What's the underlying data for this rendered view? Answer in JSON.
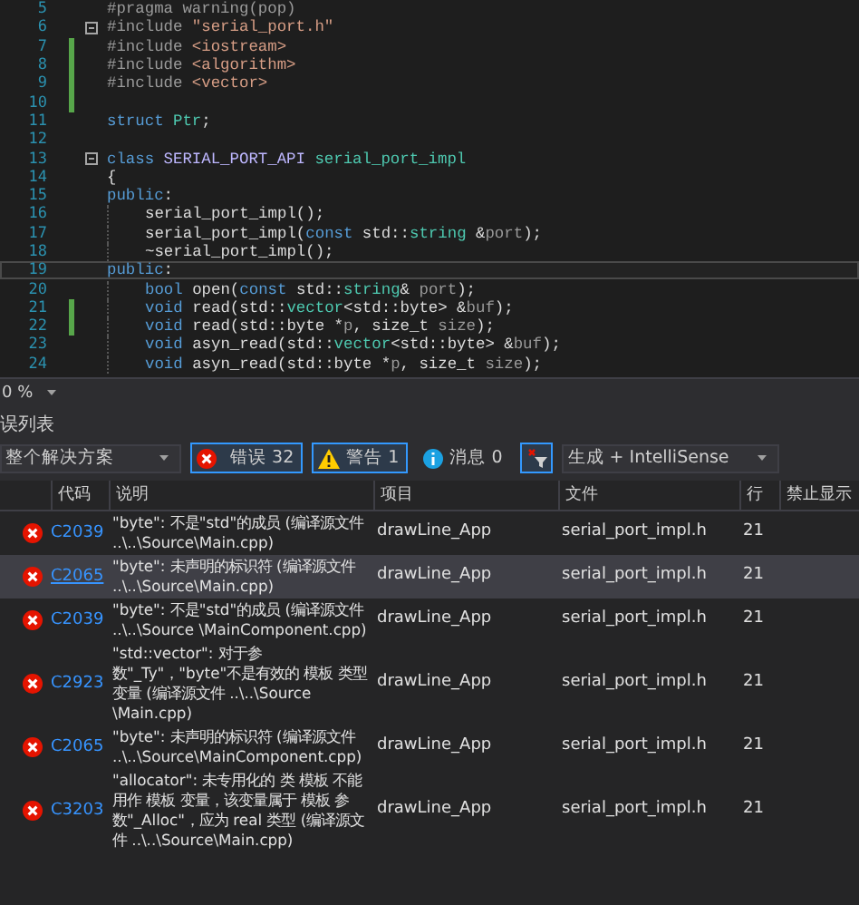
{
  "editor": {
    "lines": [
      {
        "n": "5",
        "fold": false,
        "changed": false,
        "indented": false,
        "current": false,
        "tokens": [
          {
            "t": "#pragma warning(pop)",
            "kind": "directive"
          }
        ]
      },
      {
        "n": "6",
        "fold": true,
        "changed": false,
        "indented": false,
        "current": false,
        "tokens": [
          {
            "t": "#include ",
            "kind": "directive"
          },
          {
            "t": "\"serial_port.h\"",
            "kind": "string"
          }
        ]
      },
      {
        "n": "7",
        "fold": false,
        "changed": true,
        "indented": false,
        "current": false,
        "tokens": [
          {
            "t": "#include ",
            "kind": "directive"
          },
          {
            "t": "<iostream>",
            "kind": "string"
          }
        ]
      },
      {
        "n": "8",
        "fold": false,
        "changed": true,
        "indented": false,
        "current": false,
        "tokens": [
          {
            "t": "#include ",
            "kind": "directive"
          },
          {
            "t": "<algorithm>",
            "kind": "string"
          }
        ]
      },
      {
        "n": "9",
        "fold": false,
        "changed": true,
        "indented": false,
        "current": false,
        "tokens": [
          {
            "t": "#include ",
            "kind": "directive"
          },
          {
            "t": "<vector>",
            "kind": "string"
          }
        ]
      },
      {
        "n": "10",
        "fold": false,
        "changed": true,
        "indented": false,
        "current": false
      },
      {
        "n": "11",
        "fold": false,
        "changed": false,
        "indented": false,
        "current": false,
        "tokens": [
          {
            "t": "struct ",
            "kind": "keyword"
          },
          {
            "t": "Ptr",
            "kind": "type"
          },
          {
            "t": ";",
            "kind": "plain"
          }
        ]
      },
      {
        "n": "12",
        "fold": false,
        "changed": false,
        "indented": false,
        "current": false
      },
      {
        "n": "13",
        "fold": true,
        "changed": false,
        "indented": false,
        "current": false,
        "tokens": [
          {
            "t": "class ",
            "kind": "keyword"
          },
          {
            "t": "SERIAL_PORT_API ",
            "kind": "macro"
          },
          {
            "t": "serial_port_impl",
            "kind": "type"
          }
        ]
      },
      {
        "n": "14",
        "fold": false,
        "changed": false,
        "indented": false,
        "current": false,
        "tokens": [
          {
            "t": "{",
            "kind": "plain"
          }
        ]
      },
      {
        "n": "15",
        "fold": false,
        "changed": false,
        "indented": false,
        "current": false,
        "tokens": [
          {
            "t": "public",
            "kind": "keyword"
          },
          {
            "t": ":",
            "kind": "plain"
          }
        ]
      },
      {
        "n": "16",
        "fold": false,
        "changed": false,
        "indented": true,
        "current": false,
        "tokens": [
          {
            "t": "serial_port_impl();",
            "kind": "plain"
          }
        ]
      },
      {
        "n": "17",
        "fold": false,
        "changed": false,
        "indented": true,
        "current": false,
        "tokens": [
          {
            "t": "serial_port_impl(",
            "kind": "plain"
          },
          {
            "t": "const ",
            "kind": "keyword"
          },
          {
            "t": "std::",
            "kind": "plain"
          },
          {
            "t": "string ",
            "kind": "type"
          },
          {
            "t": "&",
            "kind": "plain"
          },
          {
            "t": "port",
            "kind": "param"
          },
          {
            "t": ");",
            "kind": "plain"
          }
        ]
      },
      {
        "n": "18",
        "fold": false,
        "changed": false,
        "indented": true,
        "current": false,
        "tokens": [
          {
            "t": "~serial_port_impl();",
            "kind": "plain"
          }
        ]
      },
      {
        "n": "19",
        "fold": false,
        "changed": false,
        "indented": false,
        "current": true,
        "tokens": [
          {
            "t": "public",
            "kind": "keyword"
          },
          {
            "t": ":",
            "kind": "plain"
          }
        ]
      },
      {
        "n": "20",
        "fold": false,
        "changed": false,
        "indented": true,
        "current": false,
        "tokens": [
          {
            "t": "bool ",
            "kind": "keyword"
          },
          {
            "t": "open(",
            "kind": "plain"
          },
          {
            "t": "const ",
            "kind": "keyword"
          },
          {
            "t": "std::",
            "kind": "plain"
          },
          {
            "t": "string",
            "kind": "type"
          },
          {
            "t": "& ",
            "kind": "plain"
          },
          {
            "t": "port",
            "kind": "param"
          },
          {
            "t": ");",
            "kind": "plain"
          }
        ]
      },
      {
        "n": "21",
        "fold": false,
        "changed": true,
        "indented": true,
        "current": false,
        "tokens": [
          {
            "t": "void ",
            "kind": "keyword"
          },
          {
            "t": "read(std::",
            "kind": "plain"
          },
          {
            "t": "vector",
            "kind": "type"
          },
          {
            "t": "<std::byte> &",
            "kind": "plain"
          },
          {
            "t": "buf",
            "kind": "param"
          },
          {
            "t": ");",
            "kind": "plain"
          }
        ]
      },
      {
        "n": "22",
        "fold": false,
        "changed": true,
        "indented": true,
        "current": false,
        "tokens": [
          {
            "t": "void ",
            "kind": "keyword"
          },
          {
            "t": "read(std::byte *",
            "kind": "plain"
          },
          {
            "t": "p",
            "kind": "param"
          },
          {
            "t": ", size_t ",
            "kind": "plain"
          },
          {
            "t": "size",
            "kind": "param"
          },
          {
            "t": ");",
            "kind": "plain"
          }
        ]
      },
      {
        "n": "23",
        "fold": false,
        "changed": false,
        "indented": true,
        "current": false,
        "tokens": [
          {
            "t": "void ",
            "kind": "keyword"
          },
          {
            "t": "asyn_read(std::",
            "kind": "plain"
          },
          {
            "t": "vector",
            "kind": "type"
          },
          {
            "t": "<std::byte> &",
            "kind": "plain"
          },
          {
            "t": "buf",
            "kind": "param"
          },
          {
            "t": ");",
            "kind": "plain"
          }
        ]
      },
      {
        "n": "24",
        "fold": false,
        "changed": false,
        "indented": true,
        "current": false,
        "tokens": [
          {
            "t": "void ",
            "kind": "keyword"
          },
          {
            "t": "asyn_read(std::byte *",
            "kind": "plain"
          },
          {
            "t": "p",
            "kind": "param"
          },
          {
            "t": ", size_t ",
            "kind": "plain"
          },
          {
            "t": "size",
            "kind": "param"
          },
          {
            "t": ");",
            "kind": "plain"
          }
        ]
      }
    ],
    "zoom": "0 %"
  },
  "error_list": {
    "title": "误列表",
    "scope": "整个解决方案",
    "filters": [
      {
        "kind": "error",
        "label": "错误 32",
        "selected": true
      },
      {
        "kind": "warning",
        "label": "警告 1",
        "selected": true
      },
      {
        "kind": "info",
        "label": "消息 0",
        "selected": false
      }
    ],
    "source": "生成 + IntelliSense",
    "columns": [
      "代码",
      "说明",
      "项目",
      "文件",
      "行",
      "禁止显示"
    ],
    "rows": [
      {
        "code": "C2039",
        "selected": false,
        "description": "\"byte\": 不是\"std\"的成员 (编译源文件 ..\\..\\Source\\Main.cpp)",
        "project": "drawLine_App",
        "file": "serial_port_impl.h",
        "line": "21"
      },
      {
        "code": "C2065",
        "selected": true,
        "description": "\"byte\": 未声明的标识符 (编译源文件 ..\\..\\Source\\Main.cpp)",
        "project": "drawLine_App",
        "file": "serial_port_impl.h",
        "line": "21"
      },
      {
        "code": "C2039",
        "selected": false,
        "description": "\"byte\": 不是\"std\"的成员 (编译源文件 ..\\..\\Source \\MainComponent.cpp)",
        "project": "drawLine_App",
        "file": "serial_port_impl.h",
        "line": "21"
      },
      {
        "code": "C2923",
        "selected": false,
        "description": "\"std::vector\": 对于参数\"_Ty\"，\"byte\"不是有效的 模板 类型变量 (编译源文件 ..\\..\\Source \\Main.cpp)",
        "project": "drawLine_App",
        "file": "serial_port_impl.h",
        "line": "21"
      },
      {
        "code": "C2065",
        "selected": false,
        "description": "\"byte\": 未声明的标识符 (编译源文件 ..\\..\\Source\\MainComponent.cpp)",
        "project": "drawLine_App",
        "file": "serial_port_impl.h",
        "line": "21"
      },
      {
        "code": "C3203",
        "selected": false,
        "description": "\"allocator\": 未专用化的 类 模板 不能用作 模板 变量，该变量属于 模板 参数\"_Alloc\"，应为 real 类型 (编译源文件 ..\\..\\Source\\Main.cpp)",
        "project": "drawLine_App",
        "file": "serial_port_impl.h",
        "line": "21"
      }
    ]
  }
}
